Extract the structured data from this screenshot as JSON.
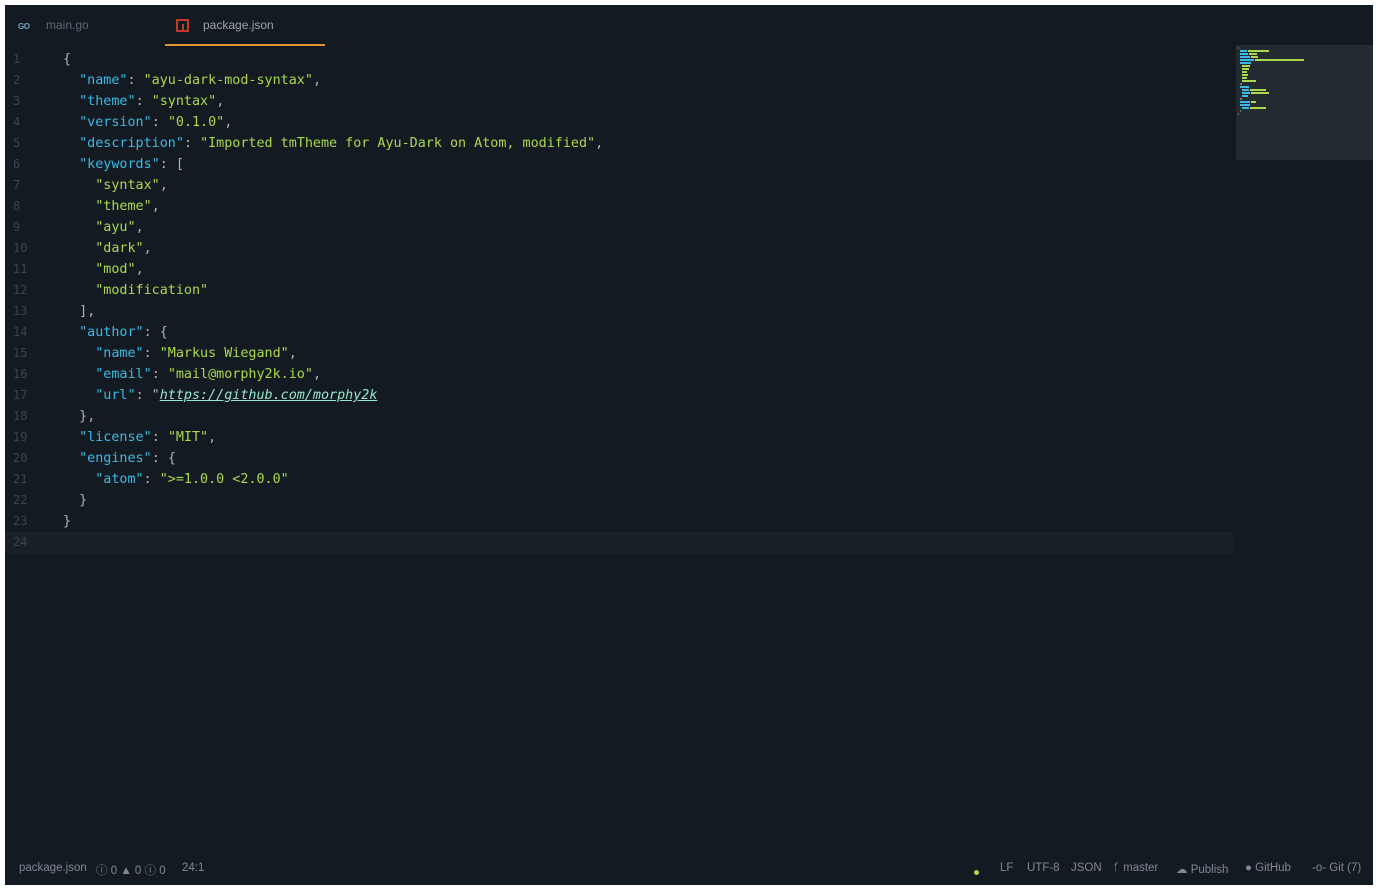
{
  "tabs": [
    {
      "label": "main.go",
      "icon": "go-file-icon",
      "active": false
    },
    {
      "label": "package.json",
      "icon": "npm-file-icon",
      "active": true
    }
  ],
  "editor": {
    "active_line": 24,
    "lines": [
      {
        "n": "1",
        "code": "{"
      },
      {
        "n": "2",
        "code": "  \"name\": \"ayu-dark-mod-syntax\","
      },
      {
        "n": "3",
        "code": "  \"theme\": \"syntax\","
      },
      {
        "n": "4",
        "code": "  \"version\": \"0.1.0\","
      },
      {
        "n": "5",
        "code": "  \"description\": \"Imported tmTheme for Ayu-Dark on Atom, modified\","
      },
      {
        "n": "6",
        "code": "  \"keywords\": ["
      },
      {
        "n": "7",
        "code": "    \"syntax\","
      },
      {
        "n": "8",
        "code": "    \"theme\","
      },
      {
        "n": "9",
        "code": "    \"ayu\","
      },
      {
        "n": "10",
        "code": "    \"dark\","
      },
      {
        "n": "11",
        "code": "    \"mod\","
      },
      {
        "n": "12",
        "code": "    \"modification\""
      },
      {
        "n": "13",
        "code": "  ],"
      },
      {
        "n": "14",
        "code": "  \"author\": {"
      },
      {
        "n": "15",
        "code": "    \"name\": \"Markus Wiegand\","
      },
      {
        "n": "16",
        "code": "    \"email\": \"mail@morphy2k.io\","
      },
      {
        "n": "17",
        "code": "    \"url\": \"https://github.com/morphy2k"
      },
      {
        "n": "18",
        "code": "  },"
      },
      {
        "n": "19",
        "code": "  \"license\": \"MIT\","
      },
      {
        "n": "20",
        "code": "  \"engines\": {"
      },
      {
        "n": "21",
        "code": "    \"atom\": \">=1.0.0 <2.0.0\""
      },
      {
        "n": "22",
        "code": "  }"
      },
      {
        "n": "23",
        "code": "}"
      },
      {
        "n": "24",
        "code": ""
      }
    ]
  },
  "status_left": {
    "file": "package.json",
    "errors": "0",
    "warnings": "0",
    "infos": "0",
    "cursor": "24:1"
  },
  "status_right": {
    "line_ending": "LF",
    "encoding": "UTF-8",
    "grammar": "JSON",
    "branch": "master",
    "publish": "Publish",
    "github": "GitHub",
    "git": "Git (7)"
  },
  "colors": {
    "background": "#141a21",
    "key": "#39bae6",
    "string": "#aad94c",
    "url": "#95e6cb",
    "tab_accent": "#e6932f"
  }
}
